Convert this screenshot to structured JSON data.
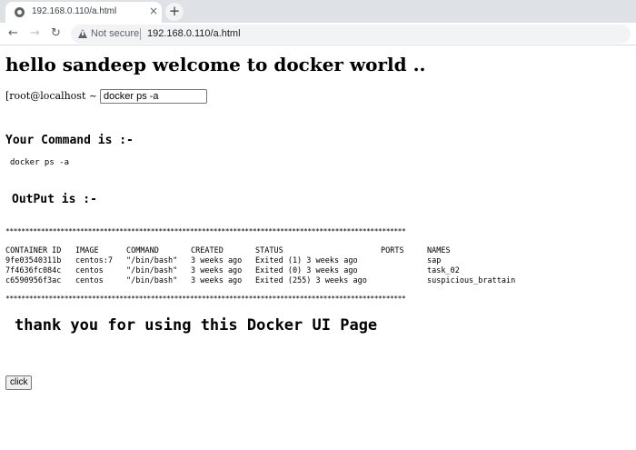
{
  "browser": {
    "tab_title": "192.168.0.110/a.html",
    "tab_close_glyph": "×",
    "new_tab_glyph": "+",
    "security_text": "Not secure",
    "url": "192.168.0.110/a.html",
    "icons": [
      "globe-icon",
      "close-icon",
      "plus-icon",
      "back-arrow-icon",
      "forward-arrow-icon",
      "reload-icon",
      "warning-icon"
    ]
  },
  "page": {
    "heading": "hello sandeep welcome to docker world ..",
    "prompt_label": "[root@localhost ~ ] # :",
    "command_value": "docker ps -a",
    "your_command_label": "Your Command is :-",
    "command_echo": "docker ps -a",
    "output_label": "OutPut is :-",
    "separator": "******************************************************************************************************",
    "table": {
      "headers": [
        "CONTAINER ID",
        "IMAGE",
        "COMMAND",
        "CREATED",
        "STATUS",
        "PORTS",
        "NAMES"
      ],
      "rows": [
        [
          "9fe03540311b",
          "centos:7",
          "\"/bin/bash\"",
          "3 weeks ago",
          "Exited (1) 3 weeks ago",
          "",
          "sap"
        ],
        [
          "7f4636fc084c",
          "centos",
          "\"/bin/bash\"",
          "3 weeks ago",
          "Exited (0) 3 weeks ago",
          "",
          "task_02"
        ],
        [
          "c6590956f3ac",
          "centos",
          "\"/bin/bash\"",
          "3 weeks ago",
          "Exited (255) 3 weeks ago",
          "",
          "suspicious_brattain"
        ]
      ]
    },
    "thanks_text": "thank you for using this Docker UI Page",
    "click_button_label": "click"
  }
}
